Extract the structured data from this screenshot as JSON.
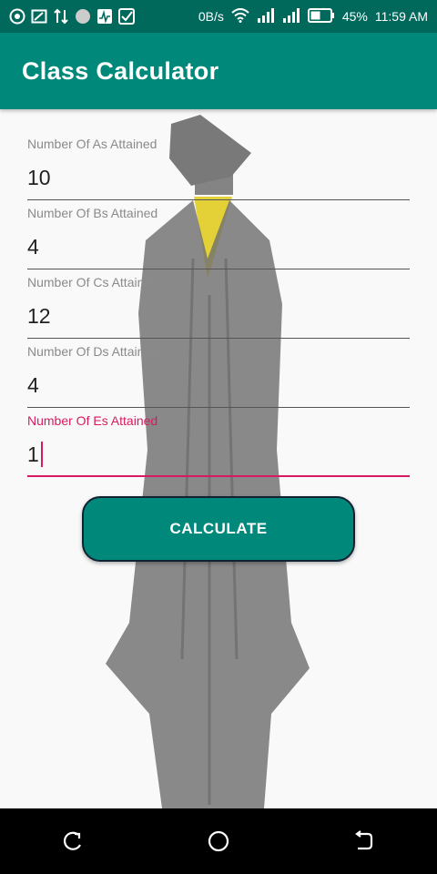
{
  "status_bar": {
    "net_speed": "0B/s",
    "battery": "45%",
    "time": "11:59 AM",
    "icons": [
      "whatsapp-icon",
      "cast-icon",
      "transfer-icon",
      "vpn-icon",
      "activity-icon",
      "check-icon",
      "wifi-icon",
      "signal-icon",
      "signal-icon",
      "battery-icon"
    ]
  },
  "app_bar": {
    "title": "Class Calculator",
    "color": "#00897b",
    "status_color": "#00695c"
  },
  "form": {
    "fields": [
      {
        "label": "Number Of As Attained",
        "value": "10"
      },
      {
        "label": "Number Of Bs Attained",
        "value": "4"
      },
      {
        "label": "Number Of Cs Attained",
        "value": "12"
      },
      {
        "label": "Number Of Ds Attained",
        "value": "4"
      },
      {
        "label": "Number Of Es Attained",
        "value": "1"
      }
    ],
    "active_color": "#d81b60"
  },
  "button": {
    "label": "CALCULATE"
  },
  "nav_bar": {
    "icons": [
      "recents-icon",
      "home-icon",
      "back-icon"
    ]
  }
}
